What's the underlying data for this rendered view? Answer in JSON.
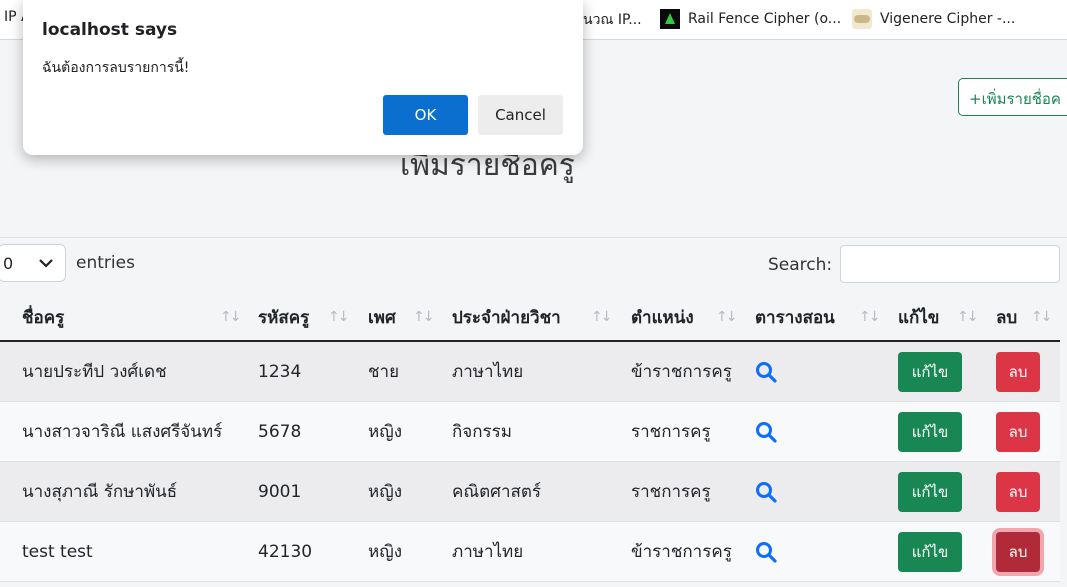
{
  "bookmarks": [
    {
      "label": "IP A",
      "icon": "page-icon"
    },
    {
      "label": "นวณ IP...",
      "icon": "page-icon"
    },
    {
      "label": "Rail Fence Cipher (o...",
      "icon": "rail-fence-icon"
    },
    {
      "label": "Vigenere Cipher -...",
      "icon": "vigenere-icon"
    }
  ],
  "page": {
    "title": "เพิ่มรายชื่อครู",
    "add_button": "+เพิ่มรายชื่อค"
  },
  "table_controls": {
    "length_value": "0",
    "entries_label": "entries",
    "search_label": "Search:",
    "search_value": ""
  },
  "table": {
    "headers": [
      "ชื่อครู",
      "รหัสครู",
      "เพศ",
      "ประจำฝ่ายวิชา",
      "ตำแหน่ง",
      "ตารางสอน",
      "แก้ไข",
      "ลบ"
    ],
    "rows": [
      {
        "name": "นายประทีป วงศ์เดช",
        "code": "1234",
        "gender": "ชาย",
        "subject": "ภาษาไทย",
        "position": "ข้าราชการครู",
        "edit": "แก้ไข",
        "delete": "ลบ"
      },
      {
        "name": "นางสาวจาริณี แสงศรีจันทร์",
        "code": "5678",
        "gender": "หญิง",
        "subject": "กิจกรรม",
        "position": "ราชการครู",
        "edit": "แก้ไข",
        "delete": "ลบ"
      },
      {
        "name": "นางสุภาณี รักษาพันธ์",
        "code": "9001",
        "gender": "หญิง",
        "subject": "คณิตศาสตร์",
        "position": "ราชการครู",
        "edit": "แก้ไข",
        "delete": "ลบ"
      },
      {
        "name": "test test",
        "code": "42130",
        "gender": "หญิง",
        "subject": "ภาษาไทย",
        "position": "ข้าราชการครู",
        "edit": "แก้ไข",
        "delete": "ลบ"
      }
    ]
  },
  "dialog": {
    "title": "localhost says",
    "message": "ฉันต้องการลบรายการนี้!",
    "ok_label": "OK",
    "cancel_label": "Cancel"
  },
  "colors": {
    "success": "#198754",
    "danger": "#dc3545",
    "primary": "#0b6fd0",
    "search_icon": "#0d6efd"
  }
}
